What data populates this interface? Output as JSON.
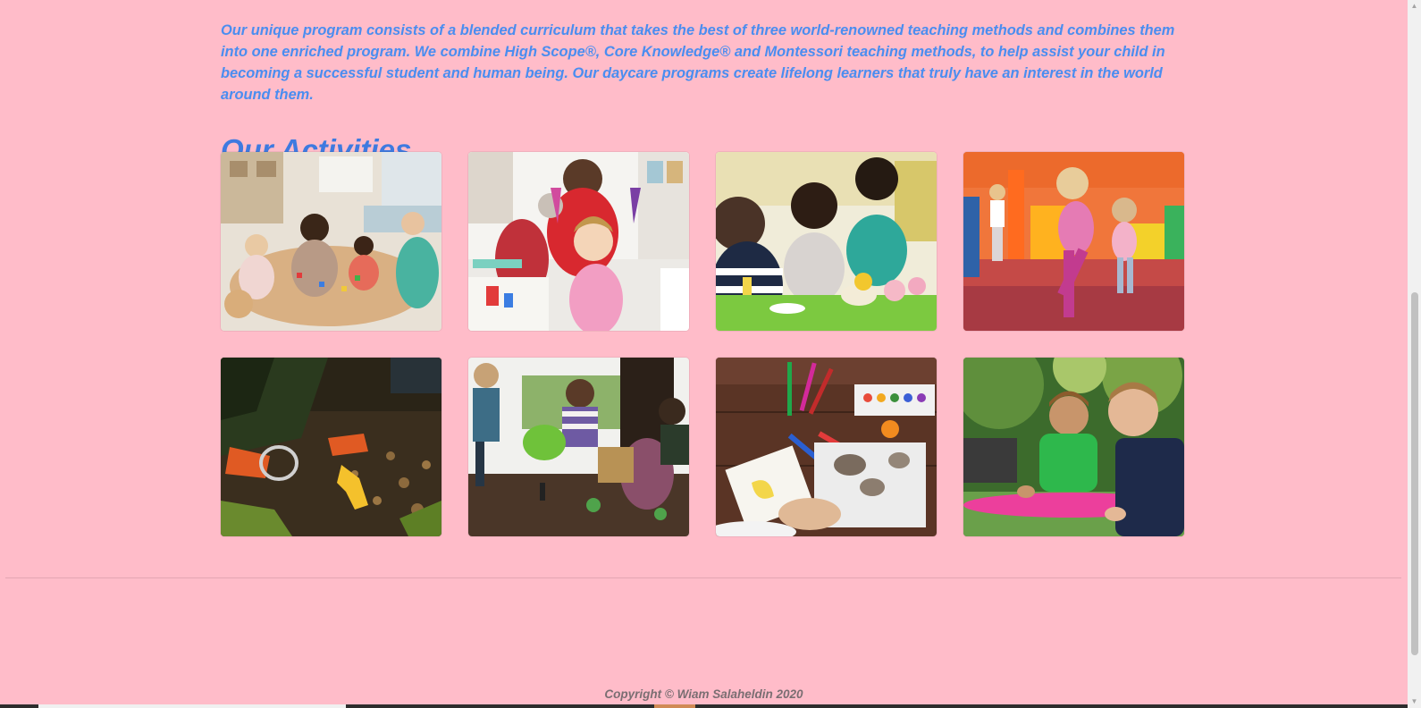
{
  "intro": {
    "text": "Our unique program consists of a blended curriculum that takes the best of three world-renowned teaching methods and combines them into one enriched program. We combine High Scope®, Core Knowledge® and Montessori teaching methods, to help assist your child in becoming a successful student and human being. Our daycare programs create lifelong learners that truly have an interest in the world around them."
  },
  "activities": {
    "title": "Our Activities",
    "photos": [
      {
        "icon": "classroom-table-photo"
      },
      {
        "icon": "finger-painting-photo"
      },
      {
        "icon": "tea-party-play-photo"
      },
      {
        "icon": "playroom-dancing-photo"
      },
      {
        "icon": "magnifying-glass-soil-photo"
      },
      {
        "icon": "garden-watering-photo"
      },
      {
        "icon": "markers-rocks-craft-photo"
      },
      {
        "icon": "outdoor-boys-play-photo"
      }
    ]
  },
  "footer": {
    "copyright": "Copyright © Wiam Salaheldin 2020"
  },
  "colors": {
    "page_background": "#ffbcc9",
    "intro_text": "#4a8df0",
    "heading_text": "#3e7ae0",
    "footer_text": "#7a6e72"
  }
}
